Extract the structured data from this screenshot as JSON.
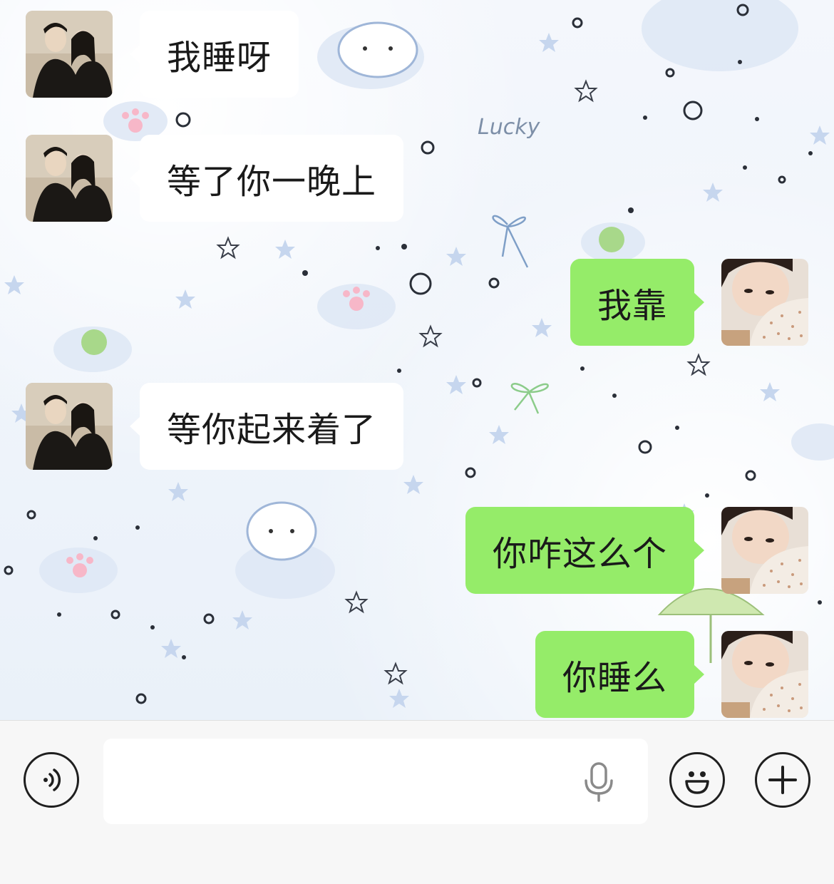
{
  "messages": [
    {
      "side": "in",
      "text": "我睡呀"
    },
    {
      "side": "in",
      "text": "等了你一晚上"
    },
    {
      "side": "out",
      "text": "我靠"
    },
    {
      "side": "in",
      "text": "等你起来着了"
    },
    {
      "side": "out",
      "text": "你咋这么个"
    },
    {
      "side": "out",
      "text": "你睡么"
    }
  ],
  "wallpaper": {
    "lucky_text": "Lucky"
  },
  "input_bar": {
    "voice_icon": "voice-mode-icon",
    "mic_icon": "microphone-icon",
    "emoji_icon": "emoji-smile-icon",
    "more_icon": "plus-icon"
  },
  "colors": {
    "outgoing_bubble": "#95ec69",
    "incoming_bubble": "#ffffff",
    "input_bar_bg": "#f7f7f7"
  }
}
